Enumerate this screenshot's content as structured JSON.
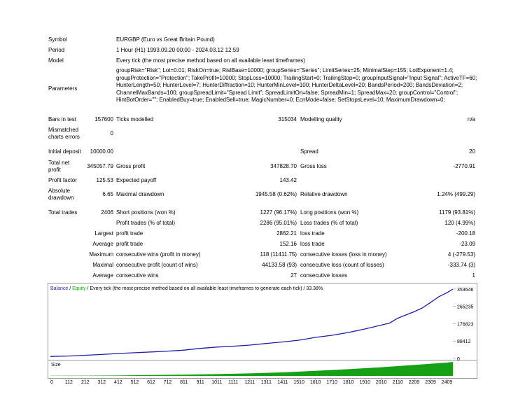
{
  "header": {
    "symbol_label": "Symbol",
    "symbol_value": "EURGBP (Euro vs Great Britain Pound)",
    "period_label": "Period",
    "period_value": "1 Hour (H1) 1993.09.20 00:00 - 2024.03.12 12:59",
    "model_label": "Model",
    "model_value": "Every tick (the most precise method based on all available least timeframes)",
    "parameters_label": "Parameters",
    "parameters_value": "groupRisk=\"Risk\"; Lot=0.01; RiskOn=true; RislBase=10000; groupSeries=\"Series\"; LimitSeries=25; MinimalStep=155; LotExponent=1.4; groupProtection=\"Protection\"; TakeProfit=10000; StopLoss=10000; TrailingStart=0; TrailingStop=0; groupInputSignal=\"Input Signal\"; ActiveTF=60; HunterLength=50; HunterLevel=7; HunterDiffraction=10; HunterMinLevel=100; HunterDeltaLevel=20; BandsPeriod=200; BandsDeviation=2; ChannelMaxBands=100; groupSpreadLimit=\"Spread Limit\"; SpreadLimitOn=false; SpreadMin=1; SpreadMax=20; groupControl=\"Control\"; HintBotOrder=\"\"; EnabledBuy=true; EnabledSell=true; MagicNumber=0; EcnMode=false; SetStopsLevel=10; MaximumDrawdown=0;"
  },
  "stats": {
    "bars_label": "Bars in test",
    "bars_value": "157600",
    "ticks_label": "Ticks modelled",
    "ticks_value": "315034",
    "quality_label": "Modelling quality",
    "quality_value": "n/a",
    "mismatch_label_1": "Mismatched",
    "mismatch_label_2": "charts errors",
    "mismatch_value": "0",
    "deposit_label": "Initial deposit",
    "deposit_value": "10000.00",
    "spread_label": "Spread",
    "spread_value": "20",
    "net_label_1": "Total net",
    "net_label_2": "profit",
    "net_value": "345057.79",
    "gross_profit_label": "Gross profit",
    "gross_profit_value": "347828.70",
    "gross_loss_label": "Gross loss",
    "gross_loss_value": "-2770.91",
    "pf_label": "Profit factor",
    "pf_value": "125.53",
    "payoff_label": "Expected payoff",
    "payoff_value": "143.42",
    "abs_dd_label_1": "Absolute",
    "abs_dd_label_2": "drawdown",
    "abs_dd_value": "6.65",
    "max_dd_label": "Maximal drawdown",
    "max_dd_value": "1945.58 (0.62%)",
    "rel_dd_label": "Relative drawdown",
    "rel_dd_value": "1.24% (499.29)",
    "trades_label": "Total trades",
    "trades_value": "2406",
    "short_label": "Short positions (won %)",
    "short_value": "1227 (96.17%)",
    "long_label": "Long positions (won %)",
    "long_value": "1179 (93.81%)",
    "profit_trades_label": "Profit trades (% of total)",
    "profit_trades_value": "2286 (95.01%)",
    "loss_trades_label": "Loss trades (% of total)",
    "loss_trades_value": "120 (4.99%)",
    "largest_label": "Largest",
    "largest_profit_label": "profit trade",
    "largest_profit_value": "2862.21",
    "largest_loss_label": "loss trade",
    "largest_loss_value": "-200.18",
    "average_label": "Average",
    "average_profit_label": "profit trade",
    "average_profit_value": "152.16",
    "average_loss_label": "loss trade",
    "average_loss_value": "-23.09",
    "maximum_label": "Maximum",
    "max_cons_wins_label": "consecutive wins (profit in money)",
    "max_cons_wins_value": "118 (11411.75)",
    "max_cons_losses_label": "consecutive losses (loss in money)",
    "max_cons_losses_value": "4 (-279.53)",
    "maximal_label": "Maximal",
    "maxl_cons_profit_label": "consecutive profit (count of wins)",
    "maxl_cons_profit_value": "44133.58 (93)",
    "maxl_cons_loss_label": "consecutive loss (count of losses)",
    "maxl_cons_loss_value": "-333.74 (3)",
    "average2_label": "Average",
    "avg_cons_wins_label": "consecutive wins",
    "avg_cons_wins_value": "27",
    "avg_cons_losses_label": "consecutive losses",
    "avg_cons_losses_value": "1"
  },
  "chart_data": {
    "type": "line",
    "title_balance": "Balance",
    "title_sep": " / ",
    "title_equity": "Equity",
    "title_rest": " / Every tick (the most precise method based on all available least timeframes to generate each tick) / 33.38%",
    "size_label": "Size",
    "y_ticks": [
      "353646",
      "265235",
      "176823",
      "88412",
      "0"
    ],
    "y_tick_values": [
      353646,
      265235,
      176823,
      88412,
      0
    ],
    "ylim": [
      0,
      353646
    ],
    "x_ticks": [
      "0",
      "112",
      "212",
      "312",
      "412",
      "512",
      "612",
      "712",
      "811",
      "911",
      "1011",
      "1111",
      "1211",
      "1311",
      "1411",
      "1510",
      "1610",
      "1710",
      "1810",
      "1910",
      "2010",
      "2110",
      "2209",
      "2309",
      "2409"
    ],
    "x_tick_values": [
      0,
      112,
      212,
      312,
      412,
      512,
      612,
      712,
      811,
      911,
      1011,
      1111,
      1211,
      1311,
      1411,
      1510,
      1610,
      1710,
      1810,
      1910,
      2010,
      2110,
      2209,
      2309,
      2409
    ],
    "xlim": [
      0,
      2445
    ],
    "series": [
      {
        "name": "Balance",
        "color": "#1f1fa6",
        "x": [
          0,
          112,
          212,
          312,
          412,
          512,
          612,
          712,
          811,
          911,
          1011,
          1111,
          1211,
          1311,
          1411,
          1510,
          1610,
          1710,
          1810,
          1910,
          2010,
          2060,
          2110,
          2160,
          2209,
          2260,
          2309,
          2360,
          2409,
          2445
        ],
        "values": [
          10000,
          12000,
          16000,
          20000,
          25000,
          29000,
          33000,
          37000,
          42000,
          51000,
          58000,
          62000,
          68000,
          76000,
          84000,
          93000,
          107000,
          118000,
          132000,
          150000,
          170000,
          180000,
          205000,
          222000,
          238000,
          258000,
          285000,
          315000,
          335000,
          353646
        ]
      }
    ],
    "lot_size": {
      "color": "#15a015",
      "x": [
        0,
        412,
        612,
        811,
        1011,
        1211,
        1411,
        1610,
        1810,
        2010,
        2209,
        2409,
        2445
      ],
      "values": [
        0.01,
        0.03,
        0.06,
        0.09,
        0.13,
        0.18,
        0.25,
        0.36,
        0.48,
        0.62,
        0.78,
        0.95,
        1.0
      ]
    }
  }
}
